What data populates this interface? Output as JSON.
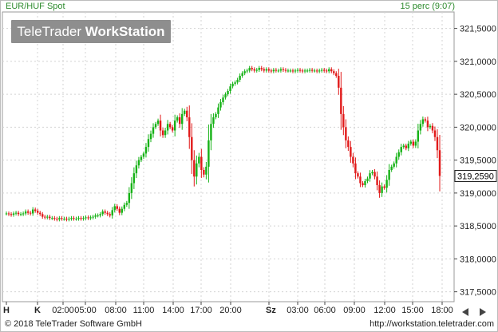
{
  "header": {
    "instrument": "EUR/HUF Spot",
    "interval": "15 perc (9:07)"
  },
  "logo": {
    "part1": "TeleTrader ",
    "part2": "WorkStation"
  },
  "footer": {
    "copyright": "© 2018 TeleTrader Software GmbH",
    "url": "http://workstation.teletrader.com"
  },
  "colors": {
    "up": "#16b216",
    "down": "#e11919",
    "grid": "#d3d3d3",
    "accent": "#2e8b2e"
  },
  "chart_data": {
    "type": "candlestick",
    "ylim": [
      317.35,
      321.75
    ],
    "yticks": [
      "317,5000",
      "318,0000",
      "318,5000",
      "319,0000",
      "319,5000",
      "320,0000",
      "320,5000",
      "321,0000",
      "321,5000"
    ],
    "ytick_values": [
      317.5,
      318.0,
      318.5,
      319.0,
      319.5,
      320.0,
      320.5,
      321.0,
      321.5
    ],
    "last_price_label": "319,2590",
    "last_price": 319.259,
    "xticks": [
      "H",
      "K",
      "02:00",
      "05:00",
      "08:00",
      "11:00",
      "14:00",
      "17:00",
      "20:00",
      "Sz",
      "03:00",
      "06:00",
      "09:00",
      "12:00",
      "15:00",
      "18:00"
    ],
    "grid": true,
    "series": [
      {
        "values": [
          318.69,
          318.68,
          318.67,
          318.69,
          318.7,
          318.68,
          318.68,
          318.69,
          318.72,
          318.7,
          318.69,
          318.75,
          318.73,
          318.7,
          318.68,
          318.64,
          318.63,
          318.64,
          318.62,
          318.62,
          318.61,
          318.6,
          318.62,
          318.61,
          318.61,
          318.6,
          318.61,
          318.62,
          318.61,
          318.61,
          318.62,
          318.61,
          318.62,
          318.63,
          318.62,
          318.63,
          318.64,
          318.66,
          318.66,
          318.68,
          318.72,
          318.7,
          318.68,
          318.66,
          318.74,
          318.8,
          318.76,
          318.7,
          318.76,
          318.82,
          318.85,
          319.0,
          319.15,
          319.3,
          319.42,
          319.5,
          319.55,
          319.6,
          319.7,
          319.82,
          319.9,
          320.0,
          320.05,
          320.1,
          319.95,
          319.88,
          319.95,
          320.05,
          320.0,
          319.95,
          320.1,
          320.15,
          320.05,
          320.2,
          320.25,
          320.15,
          319.85,
          319.5,
          319.25,
          319.45,
          319.55,
          319.35,
          319.28,
          319.4,
          319.8,
          320.05,
          320.15,
          320.2,
          320.3,
          320.38,
          320.45,
          320.5,
          320.55,
          320.62,
          320.66,
          320.68,
          320.72,
          320.78,
          320.82,
          320.85,
          320.86,
          320.9,
          320.88,
          320.86,
          320.87,
          320.9,
          320.88,
          320.86,
          320.88,
          320.86,
          320.85,
          320.87,
          320.86,
          320.86,
          320.88,
          320.87,
          320.86,
          320.86,
          320.86,
          320.85,
          320.86,
          320.87,
          320.86,
          320.85,
          320.86,
          320.86,
          320.87,
          320.86,
          320.86,
          320.85,
          320.86,
          320.87,
          320.86,
          320.85,
          320.88,
          320.85,
          320.82,
          320.78,
          320.6,
          320.2,
          320.0,
          319.8,
          319.7,
          319.55,
          319.45,
          319.3,
          319.25,
          319.15,
          319.12,
          319.18,
          319.22,
          319.3,
          319.32,
          319.25,
          319.12,
          319.0,
          319.1,
          319.08,
          319.2,
          319.35,
          319.4,
          319.45,
          319.55,
          319.62,
          319.7,
          319.72,
          319.68,
          319.75,
          319.78,
          319.72,
          319.78,
          319.95,
          320.05,
          320.12,
          320.1,
          320.0,
          320.02,
          319.95,
          319.85,
          319.65,
          319.26
        ]
      }
    ]
  }
}
